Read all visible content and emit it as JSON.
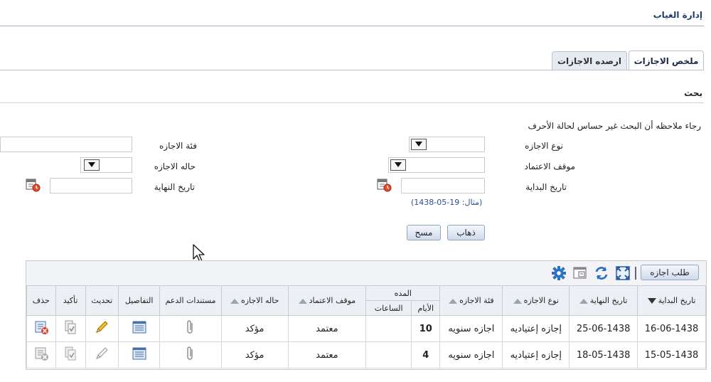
{
  "header": {
    "title": "إدارة الغياب"
  },
  "tabs": [
    {
      "label": "ملخص الاجازات",
      "active": true
    },
    {
      "label": "ارصده الاجازات",
      "active": false
    }
  ],
  "search": {
    "heading": "بحث",
    "note": "رجاء ملاحظه أن البحث غير حساس لحالة الأحرف",
    "labels": {
      "leave_type": "نوع الاجازه",
      "approval_status": "موقف الاعتماد",
      "start_date": "تاريخ البداية",
      "leave_category": "فئة الاجازه",
      "leave_status": "حاله الاجازه",
      "end_date": "تاريخ النهاية"
    },
    "date_example": "(مثال: 19-05-1438)",
    "go_label": "ذهاب",
    "clear_label": "مسح"
  },
  "toolbar": {
    "request_leave_label": "طلب اجازه"
  },
  "colors": {
    "accent": "#1c3b6e",
    "link": "#2a4e9a",
    "header_bg": "#eceff4"
  },
  "table": {
    "duration_group": "المده",
    "headers": {
      "start_date": "تاريخ البداية",
      "end_date": "تاريخ النهاية",
      "leave_type": "نوع الاجازه",
      "leave_category": "فئة الاجازه",
      "days": "الأيام",
      "hours": "الساعات",
      "approval_status": "موقف الاعتماد",
      "leave_status": "حاله الاجازه",
      "supporting_docs": "مستندات الدعم",
      "details": "التفاصيل",
      "update": "تحديث",
      "confirm": "تأكيد",
      "delete": "حذف"
    },
    "rows": [
      {
        "start_date": "16-06-1438",
        "end_date": "25-06-1438",
        "leave_type": "إجازه إعتياديه",
        "leave_category": "اجازه سنويه",
        "days": "10",
        "hours": "",
        "approval_status": "معتمد",
        "leave_status": "مؤكد"
      },
      {
        "start_date": "15-05-1438",
        "end_date": "18-05-1438",
        "leave_type": "إجازه إعتياديه",
        "leave_category": "اجازه سنويه",
        "days": "4",
        "hours": "",
        "approval_status": "معتمد",
        "leave_status": "مؤكد"
      }
    ]
  }
}
